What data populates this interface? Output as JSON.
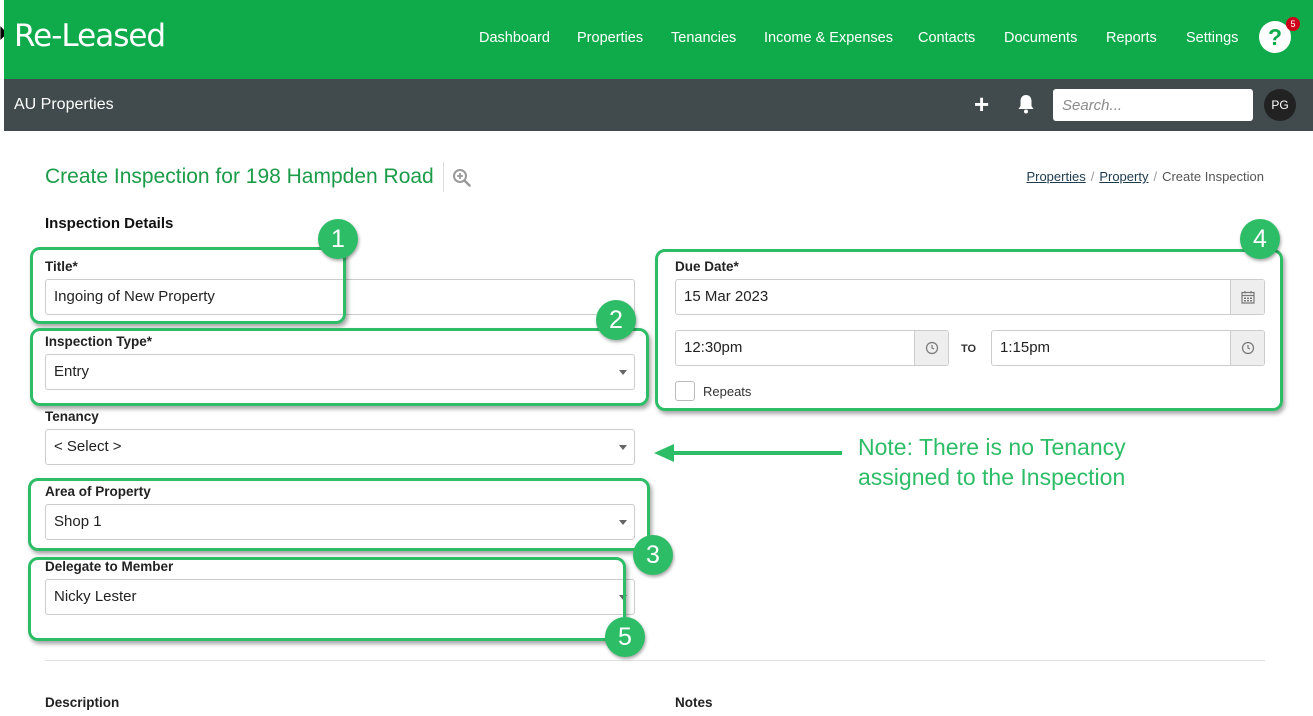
{
  "app": {
    "logo": "Re-Leased",
    "nav": [
      "Dashboard",
      "Properties",
      "Tenancies",
      "Income & Expenses",
      "Contacts",
      "Documents",
      "Reports",
      "Settings"
    ],
    "help_label": "?",
    "help_badge": "5",
    "brand_color": "#0fab4b",
    "subbar_color": "#414a4c"
  },
  "subbar": {
    "org": "AU Properties",
    "add_label": "+",
    "search_placeholder": "Search...",
    "avatar": "PG"
  },
  "page": {
    "title": "Create Inspection for 198 Hampden Road",
    "breadcrumb": [
      "Properties",
      "Property",
      "Create Inspection"
    ],
    "section": "Inspection Details"
  },
  "form": {
    "title_label": "Title*",
    "title_value": "Ingoing of New Property",
    "type_label": "Inspection Type*",
    "type_value": "Entry",
    "tenancy_label": "Tenancy",
    "tenancy_value": "< Select >",
    "area_label": "Area of Property",
    "area_value": "Shop 1",
    "delegate_label": "Delegate to Member",
    "delegate_value": "Nicky Lester",
    "due_label": "Due Date*",
    "due_value": "15 Mar 2023",
    "time_from": "12:30pm",
    "to_label": "TO",
    "time_to": "1:15pm",
    "repeats_label": "Repeats",
    "description_label": "Description",
    "notes_label": "Notes"
  },
  "annotations": {
    "badges": [
      "1",
      "2",
      "3",
      "4",
      "5"
    ],
    "note_line1": "Note: There is no Tenancy",
    "note_line2": "assigned to the Inspection",
    "accent": "#2ebd67"
  }
}
